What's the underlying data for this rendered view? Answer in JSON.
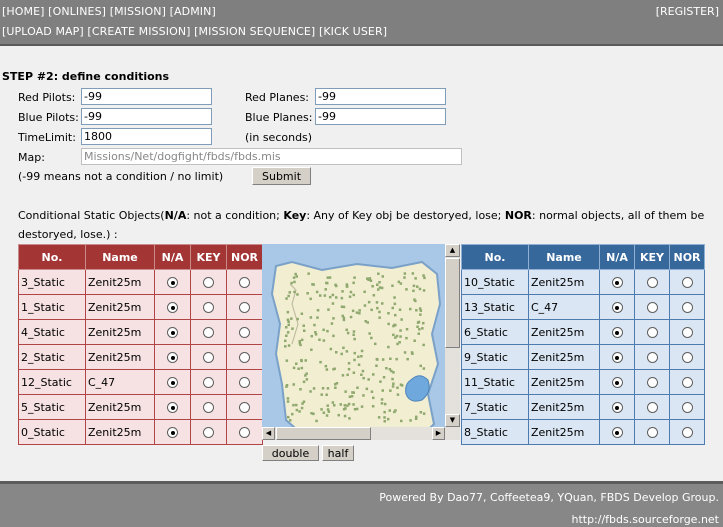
{
  "nav": {
    "row1": [
      "[HOME]",
      "[ONLINES]",
      "[MISSION]",
      "[ADMIN]"
    ],
    "register": "[REGISTER]",
    "row2": [
      "[UPLOAD MAP]",
      "[CREATE MISSION]",
      "[MISSION SEQUENCE]",
      "[KICK USER]"
    ]
  },
  "form": {
    "title": "STEP #2: define conditions",
    "red_pilots_label": "Red Pilots:",
    "red_pilots_value": "-99",
    "red_planes_label": "Red Planes:",
    "red_planes_value": "-99",
    "blue_pilots_label": "Blue Pilots:",
    "blue_pilots_value": "-99",
    "blue_planes_label": "Blue Planes:",
    "blue_planes_value": "-99",
    "timelimit_label": "TimeLimit:",
    "timelimit_value": "1800",
    "seconds_note": "(in seconds)",
    "map_label": "Map:",
    "map_value": "Missions/Net/dogfight/fbds/fbds.mis",
    "nolimit_note": "(-99 means not a condition / no limit)",
    "submit_label": "Submit"
  },
  "conditions": {
    "prefix": "Conditional Static Objects(",
    "na_key": "N/A",
    "na_text": ": not a condition; ",
    "key_key": "Key",
    "key_text": ": Any of Key obj be destoryed, lose; ",
    "nor_key": "NOR",
    "nor_text": ": normal objects, all of them be destoryed, lose.) :"
  },
  "red_table": {
    "headers": [
      "No.",
      "Name",
      "N/A",
      "KEY",
      "NOR"
    ],
    "rows": [
      {
        "no": "3_Static",
        "name": "Zenit25m",
        "selected": "N/A"
      },
      {
        "no": "1_Static",
        "name": "Zenit25m",
        "selected": "N/A"
      },
      {
        "no": "4_Static",
        "name": "Zenit25m",
        "selected": "N/A"
      },
      {
        "no": "2_Static",
        "name": "Zenit25m",
        "selected": "N/A"
      },
      {
        "no": "12_Static",
        "name": "C_47",
        "selected": "N/A"
      },
      {
        "no": "5_Static",
        "name": "Zenit25m",
        "selected": "N/A"
      },
      {
        "no": "0_Static",
        "name": "Zenit25m",
        "selected": "N/A"
      }
    ]
  },
  "blue_table": {
    "headers": [
      "No.",
      "Name",
      "N/A",
      "KEY",
      "NOR"
    ],
    "rows": [
      {
        "no": "10_Static",
        "name": "Zenit25m",
        "selected": "N/A"
      },
      {
        "no": "13_Static",
        "name": "C_47",
        "selected": "N/A"
      },
      {
        "no": "6_Static",
        "name": "Zenit25m",
        "selected": "N/A"
      },
      {
        "no": "9_Static",
        "name": "Zenit25m",
        "selected": "N/A"
      },
      {
        "no": "11_Static",
        "name": "Zenit25m",
        "selected": "N/A"
      },
      {
        "no": "7_Static",
        "name": "Zenit25m",
        "selected": "N/A"
      },
      {
        "no": "8_Static",
        "name": "Zenit25m",
        "selected": "N/A"
      }
    ]
  },
  "map_view": {
    "double_label": "double",
    "half_label": "half"
  },
  "footer": {
    "line1": "Powered By Dao77, Coffeetea9, YQuan, FBDS Develop Group.",
    "line2": "http://fbds.sourceforge.net"
  },
  "colors": {
    "red_header": "#a33535",
    "blue_header": "#36689c",
    "bar": "#7f7f7f"
  }
}
